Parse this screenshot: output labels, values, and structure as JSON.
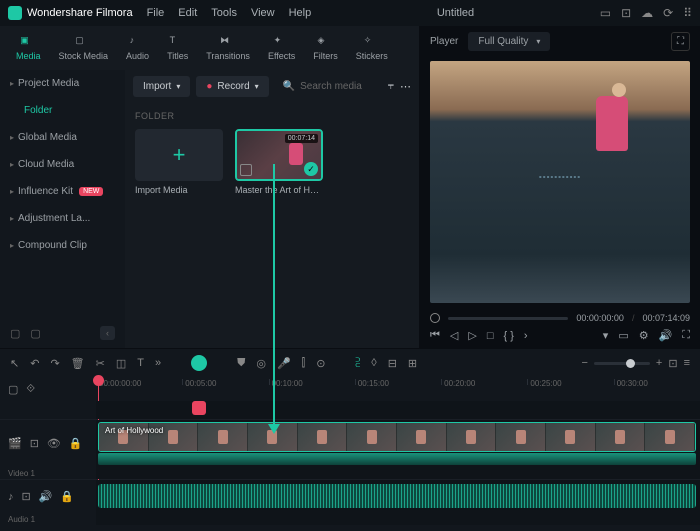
{
  "app": {
    "name": "Wondershare Filmora",
    "title": "Untitled"
  },
  "menu": [
    "File",
    "Edit",
    "Tools",
    "View",
    "Help"
  ],
  "tabs": [
    {
      "label": "Media",
      "active": true
    },
    {
      "label": "Stock Media"
    },
    {
      "label": "Audio"
    },
    {
      "label": "Titles"
    },
    {
      "label": "Transitions"
    },
    {
      "label": "Effects"
    },
    {
      "label": "Filters"
    },
    {
      "label": "Stickers"
    }
  ],
  "sidebar": {
    "items": [
      {
        "label": "Project Media"
      },
      {
        "label": "Folder",
        "active": true
      },
      {
        "label": "Global Media"
      },
      {
        "label": "Cloud Media"
      },
      {
        "label": "Influence Kit",
        "badge": "NEW"
      },
      {
        "label": "Adjustment La..."
      },
      {
        "label": "Compound Clip"
      }
    ]
  },
  "toolbar": {
    "import": "Import",
    "record": "Record",
    "search_placeholder": "Search media"
  },
  "folder": {
    "label": "FOLDER"
  },
  "media": {
    "import_label": "Import Media",
    "clip_label": "Master the Art of Holl...",
    "clip_duration": "00:07:14"
  },
  "player": {
    "label": "Player",
    "quality": "Full Quality",
    "time_current": "00:00:00:00",
    "time_total": "00:07:14:09"
  },
  "ruler": [
    "00:00:00:00",
    "00:05:00",
    "00:10:00",
    "00:15:00",
    "00:20:00",
    "00:25:00",
    "00:30:00"
  ],
  "tracks": {
    "video": {
      "label": "Video 1"
    },
    "audio": {
      "label": "Audio 1"
    },
    "clip_title": "Art of Hollywood"
  }
}
